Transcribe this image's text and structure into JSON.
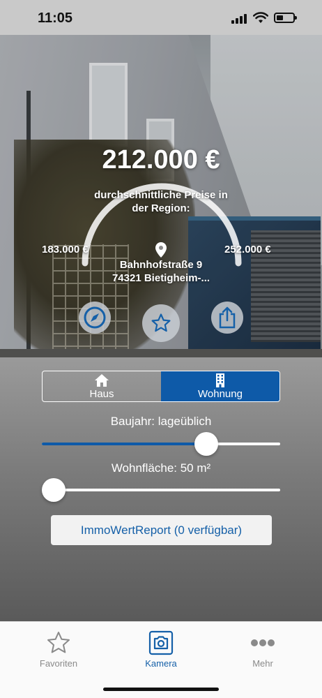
{
  "status_bar": {
    "time": "11:05"
  },
  "estimate": {
    "price": "212.000 €",
    "avg_label": "durchschnittliche Preise in der Region:",
    "min_price": "183.000 €",
    "max_price": "252.000 €",
    "address_line1": "Bahnhofstraße 9",
    "address_line2": "74321 Bietigheim-..."
  },
  "actions": {
    "navigate_icon": "compass-icon",
    "favorite_icon": "star-icon",
    "share_icon": "share-icon"
  },
  "property_type": {
    "options": [
      {
        "label": "Haus",
        "icon": "house-icon",
        "selected": false
      },
      {
        "label": "Wohnung",
        "icon": "building-icon",
        "selected": true
      }
    ]
  },
  "sliders": {
    "baujahr": {
      "label": "Baujahr: lageüblich",
      "fraction": 0.71
    },
    "wohnflaeche": {
      "label": "Wohnfläche: 50 m²",
      "fraction": 0.0
    }
  },
  "report_button": {
    "label": "ImmoWertReport (0 verfügbar)"
  },
  "tabbar": {
    "tabs": [
      {
        "label": "Favoriten",
        "icon": "star-outline-icon",
        "active": false
      },
      {
        "label": "Kamera",
        "icon": "camera-icon",
        "active": true
      },
      {
        "label": "Mehr",
        "icon": "more-dots-icon",
        "active": false
      }
    ]
  },
  "colors": {
    "accent": "#0e5aa8",
    "link": "#1560a8"
  }
}
